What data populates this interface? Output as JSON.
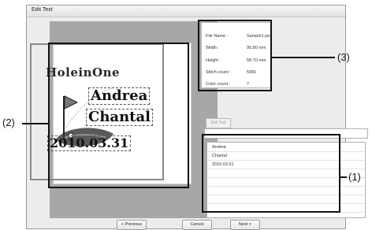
{
  "window": {
    "title": "Edit Text"
  },
  "preview": {
    "design_texts": {
      "holein": "HoleinOne",
      "andrea": "Andrea",
      "chantal": "Chantal",
      "date": "2010.03.31"
    }
  },
  "info": {
    "file_name_label": "File Name :",
    "file_name_value": "Sample1.pes",
    "width_label": "Width :",
    "width_value": "95.80 mm",
    "height_label": "Height :",
    "height_value": "58.70 mm",
    "stitch_label": "Stitch count :",
    "stitch_value": "5081",
    "color_label": "Color count :",
    "color_value": "7"
  },
  "edit_text_button": "Edit Text",
  "text_list": [
    "Andrea",
    "Chantal",
    "2010.03.31"
  ],
  "buttons": {
    "previous": "< Previous",
    "cancel": "Cancel",
    "next": "Next >"
  },
  "callouts": {
    "one": "(1)",
    "two": "(2)",
    "three": "(3)"
  }
}
